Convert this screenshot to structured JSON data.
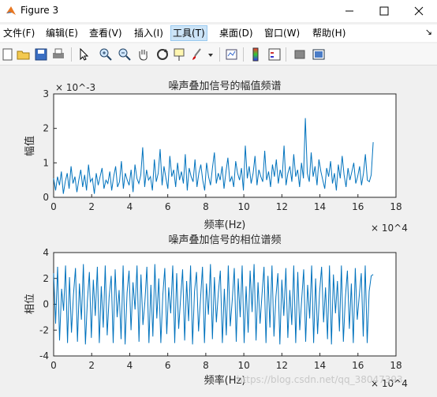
{
  "window": {
    "title": "Figure 3"
  },
  "menu": [
    {
      "label": "文件(F)"
    },
    {
      "label": "编辑(E)"
    },
    {
      "label": "查看(V)"
    },
    {
      "label": "插入(I)"
    },
    {
      "label": "工具(T)"
    },
    {
      "label": "桌面(D)"
    },
    {
      "label": "窗口(W)"
    },
    {
      "label": "帮助(H)"
    }
  ],
  "toolbar_icons": [
    "new-figure-icon",
    "open-file-icon",
    "save-icon",
    "print-icon",
    "select-arrow-icon",
    "zoom-in-icon",
    "zoom-out-icon",
    "pan-hand-icon",
    "rotate-3d-icon",
    "data-cursor-icon",
    "brush-icon",
    "brush-dropdown-icon",
    "link-plot-icon",
    "colorbar-icon",
    "legend-icon",
    "hide-plot-tools-icon",
    "show-plot-tools-icon"
  ],
  "watermark": "https://blog.csdn.net/qq_38047393",
  "chart_data": [
    {
      "type": "line",
      "title": "噪声叠加信号的幅值频谱",
      "xlabel": "频率(Hz)",
      "ylabel": "幅值",
      "x_exponent": "× 10^4",
      "y_exponent": "× 10^-3",
      "xlim": [
        0,
        18
      ],
      "ylim": [
        0,
        3
      ],
      "xticks": [
        "0",
        "2",
        "4",
        "6",
        "8",
        "10",
        "12",
        "14",
        "16",
        "18"
      ],
      "yticks": [
        "0",
        "1",
        "2",
        "3"
      ],
      "color": "#0072bd",
      "series": [
        {
          "x_range": [
            0,
            16.8
          ],
          "values": [
            0.55,
            0.2,
            0.6,
            0.35,
            0.75,
            0.1,
            0.45,
            0.7,
            0.25,
            0.9,
            0.4,
            0.6,
            0.15,
            0.5,
            0.8,
            0.3,
            0.65,
            0.2,
            0.95,
            0.45,
            0.55,
            0.1,
            0.7,
            0.35,
            0.6,
            0.85,
            0.25,
            0.5,
            0.4,
            0.75,
            0.2,
            0.6,
            0.9,
            0.3,
            0.45,
            1.05,
            0.25,
            0.7,
            0.5,
            0.35,
            0.8,
            0.15,
            0.95,
            0.55,
            0.4,
            0.65,
            1.45,
            0.3,
            0.8,
            0.5,
            0.6,
            0.2,
            1.1,
            0.45,
            0.7,
            1.4,
            0.35,
            0.9,
            0.55,
            0.25,
            1.2,
            0.6,
            0.8,
            0.3,
            1.0,
            0.5,
            0.75,
            0.4,
            1.25,
            0.2,
            0.85,
            0.6,
            0.45,
            1.1,
            0.3,
            0.7,
            0.95,
            0.5,
            0.2,
            1.0,
            0.6,
            0.35,
            0.85,
            1.3,
            0.4,
            0.7,
            0.5,
            0.9,
            0.25,
            0.75,
            1.15,
            0.45,
            0.6,
            0.3,
            1.05,
            0.7,
            0.5,
            0.85,
            0.2,
            1.5,
            0.55,
            0.9,
            0.4,
            0.7,
            1.2,
            0.35,
            0.8,
            0.6,
            0.45,
            1.35,
            0.5,
            0.75,
            0.3,
            0.95,
            0.6,
            1.1,
            0.4,
            0.8,
            0.55,
            1.5,
            0.35,
            0.7,
            0.9,
            0.45,
            1.25,
            0.6,
            0.8,
            0.3,
            1.0,
            0.55,
            2.3,
            0.7,
            0.45,
            1.3,
            0.6,
            0.9,
            0.35,
            1.1,
            0.75,
            0.5,
            0.25,
            0.85,
            0.6,
            1.05,
            0.4,
            0.7,
            0.2,
            0.95,
            0.55,
            1.2,
            0.65,
            0.3,
            0.85,
            0.5,
            0.75,
            1.0,
            0.4,
            0.6,
            0.9,
            0.35,
            0.7,
            1.25,
            0.5,
            0.45,
            0.65,
            1.6
          ]
        }
      ]
    },
    {
      "type": "line",
      "title": "噪声叠加信号的相位谱频",
      "xlabel": "频率(Hz)",
      "ylabel": "相位",
      "x_exponent": "× 10^4",
      "xlim": [
        0,
        18
      ],
      "ylim": [
        -4,
        4
      ],
      "xticks": [
        "0",
        "2",
        "4",
        "6",
        "8",
        "10",
        "12",
        "14",
        "16",
        "18"
      ],
      "yticks": [
        "-4",
        "-2",
        "0",
        "2",
        "4"
      ],
      "color": "#0072bd",
      "series": [
        {
          "x_range": [
            0,
            16.8
          ],
          "values": [
            2.4,
            -1.5,
            2.9,
            -2.8,
            1.2,
            -0.5,
            3.0,
            -3.0,
            2.1,
            -2.2,
            0.8,
            2.8,
            -2.9,
            1.6,
            -1.2,
            3.1,
            -3.1,
            0.3,
            2.5,
            -2.6,
            1.9,
            -0.9,
            2.9,
            -3.0,
            1.4,
            -1.8,
            3.0,
            -2.4,
            0.6,
            2.2,
            -3.0,
            2.7,
            -1.0,
            1.1,
            -2.7,
            3.0,
            -3.1,
            0.9,
            2.6,
            -2.0,
            1.7,
            -0.4,
            3.0,
            -2.9,
            2.3,
            -1.6,
            0.2,
            2.9,
            -3.0,
            1.5,
            -2.5,
            3.1,
            -1.1,
            2.0,
            -3.0,
            0.7,
            2.8,
            -2.3,
            1.3,
            -0.7,
            3.0,
            -3.0,
            2.4,
            -1.9,
            0.5,
            2.7,
            -2.8,
            1.8,
            -1.3,
            3.0,
            -3.1,
            1.0,
            2.5,
            -2.1,
            0.4,
            2.9,
            -3.0,
            1.6,
            -0.8,
            3.1,
            -2.7,
            2.1,
            -1.4,
            0.9,
            2.6,
            -3.0,
            1.2,
            -2.4,
            3.0,
            -1.7,
            0.3,
            2.8,
            -2.9,
            2.0,
            -1.0,
            3.0,
            -3.0,
            1.4,
            -2.2,
            2.6,
            -0.6,
            3.1,
            -2.8,
            1.7,
            -1.5,
            0.8,
            2.9,
            -3.0,
            2.2,
            -1.8,
            3.0,
            -2.5,
            0.6,
            2.4,
            -3.1,
            1.9,
            -0.9,
            2.8,
            -2.6,
            1.1,
            -1.6,
            3.0,
            -3.0,
            2.5,
            -2.0,
            0.4,
            2.7,
            -2.9,
            1.5,
            -1.1,
            3.0,
            -3.0,
            2.0,
            -2.3,
            0.9,
            2.9,
            -1.4,
            1.3,
            -2.7,
            3.0,
            -3.1,
            2.3,
            -0.7,
            1.8,
            -2.1,
            3.0,
            -2.9,
            0.5,
            2.6,
            -1.9,
            1.6,
            -3.0,
            2.8,
            -1.2,
            0.7,
            2.4,
            -2.5,
            3.0,
            -3.0,
            1.0,
            2.2,
            2.3
          ]
        }
      ]
    }
  ]
}
